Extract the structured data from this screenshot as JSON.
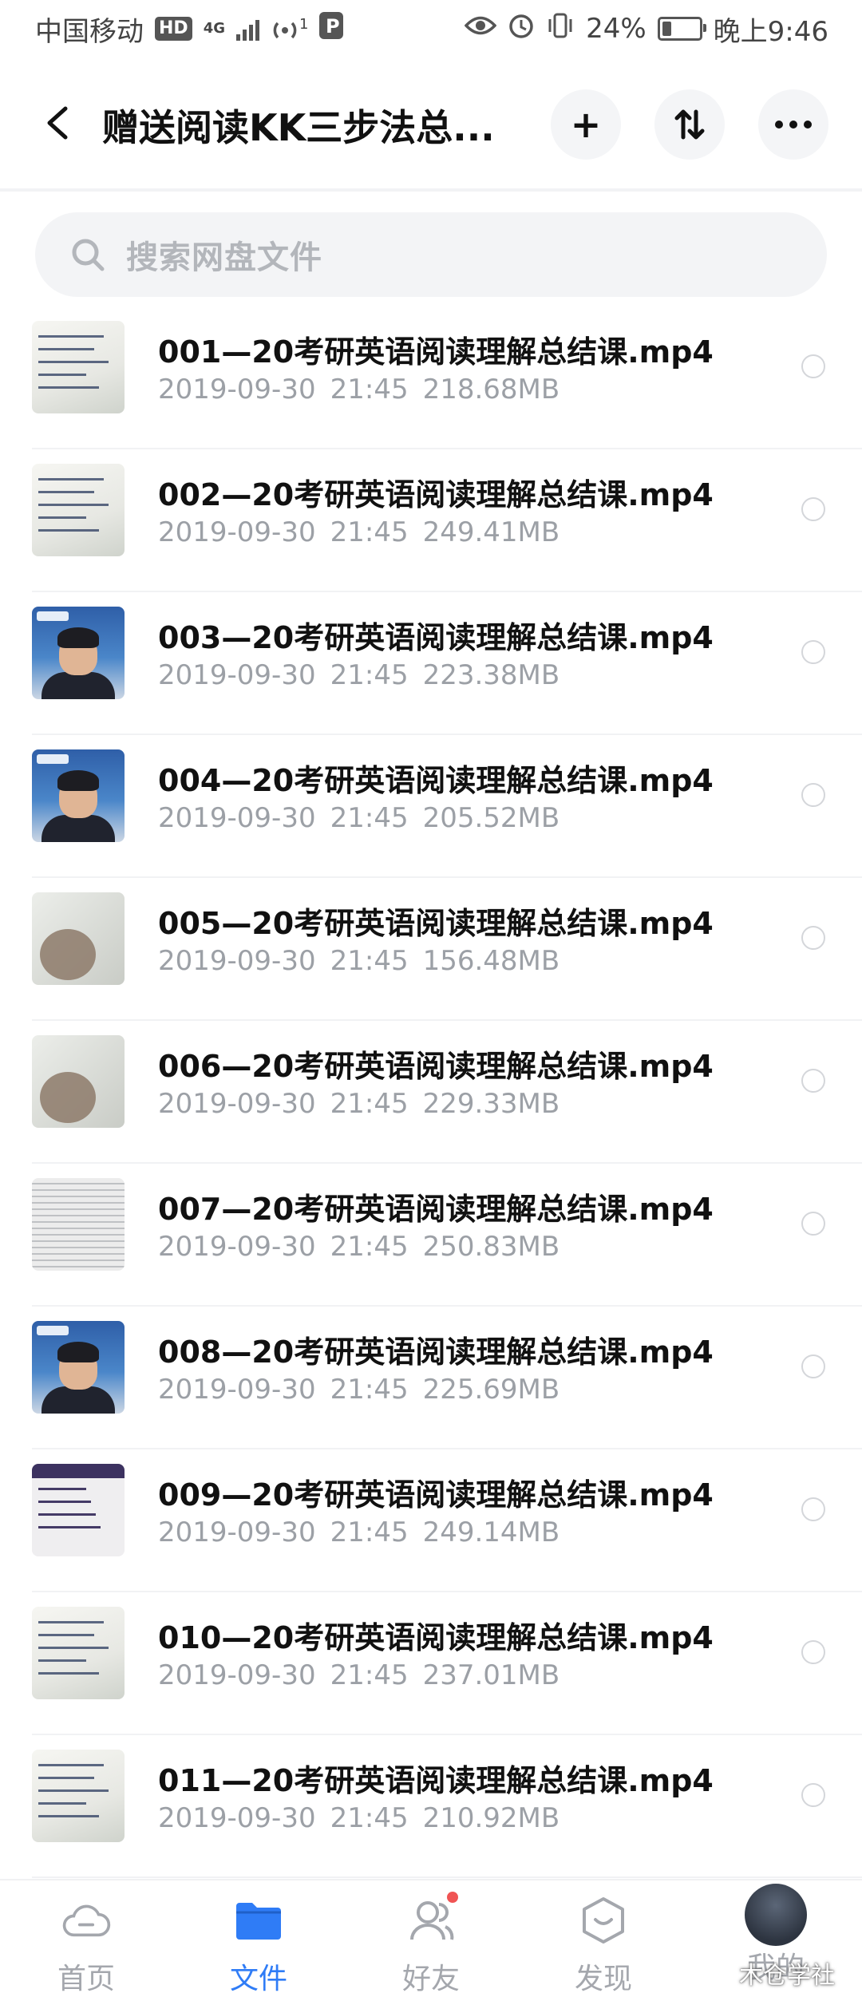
{
  "status_bar": {
    "carrier": "中国移动",
    "hd_badge": "HD",
    "network": "4G",
    "hotspot_count": "1",
    "battery_percent": "24%",
    "time": "晚上9:46",
    "battery_level": 0.24
  },
  "header": {
    "title": "赠送阅读KK三步法总...",
    "icons": [
      "back-icon",
      "plus-icon",
      "sort-icon",
      "more-icon"
    ],
    "add_symbol": "+",
    "sort_symbol": "⇅",
    "more_symbol": "•••"
  },
  "search": {
    "placeholder": "搜索网盘文件"
  },
  "files": [
    {
      "name": "001—20考研英语阅读理解总结课.mp4",
      "date": "2019-09-30",
      "time": "21:45",
      "size": "218.68MB",
      "thumb": "paper"
    },
    {
      "name": "002—20考研英语阅读理解总结课.mp4",
      "date": "2019-09-30",
      "time": "21:45",
      "size": "249.41MB",
      "thumb": "paper"
    },
    {
      "name": "003—20考研英语阅读理解总结课.mp4",
      "date": "2019-09-30",
      "time": "21:45",
      "size": "223.38MB",
      "thumb": "teacher"
    },
    {
      "name": "004—20考研英语阅读理解总结课.mp4",
      "date": "2019-09-30",
      "time": "21:45",
      "size": "205.52MB",
      "thumb": "teacher"
    },
    {
      "name": "005—20考研英语阅读理解总结课.mp4",
      "date": "2019-09-30",
      "time": "21:45",
      "size": "156.48MB",
      "thumb": "hand"
    },
    {
      "name": "006—20考研英语阅读理解总结课.mp4",
      "date": "2019-09-30",
      "time": "21:45",
      "size": "229.33MB",
      "thumb": "hand"
    },
    {
      "name": "007—20考研英语阅读理解总结课.mp4",
      "date": "2019-09-30",
      "time": "21:45",
      "size": "250.83MB",
      "thumb": "book"
    },
    {
      "name": "008—20考研英语阅读理解总结课.mp4",
      "date": "2019-09-30",
      "time": "21:45",
      "size": "225.69MB",
      "thumb": "teacher"
    },
    {
      "name": "009—20考研英语阅读理解总结课.mp4",
      "date": "2019-09-30",
      "time": "21:45",
      "size": "249.14MB",
      "thumb": "screen"
    },
    {
      "name": "010—20考研英语阅读理解总结课.mp4",
      "date": "2019-09-30",
      "time": "21:45",
      "size": "237.01MB",
      "thumb": "paper"
    },
    {
      "name": "011—20考研英语阅读理解总结课.mp4",
      "date": "2019-09-30",
      "time": "21:45",
      "size": "210.92MB",
      "thumb": "paper"
    }
  ],
  "tabbar": {
    "tabs": [
      {
        "label": "首页",
        "icon": "cloud-icon",
        "active": false
      },
      {
        "label": "文件",
        "icon": "folder-icon",
        "active": true
      },
      {
        "label": "好友",
        "icon": "friends-icon",
        "active": false,
        "badge": true
      },
      {
        "label": "发现",
        "icon": "discover-icon",
        "active": false
      },
      {
        "label": "我的",
        "icon": "avatar",
        "active": false
      }
    ]
  },
  "watermark": "木仓学社",
  "colors": {
    "accent": "#2f7cf6",
    "inactive": "#a4a7ad",
    "badge": "#f05454",
    "meta": "#9ca0a6"
  }
}
